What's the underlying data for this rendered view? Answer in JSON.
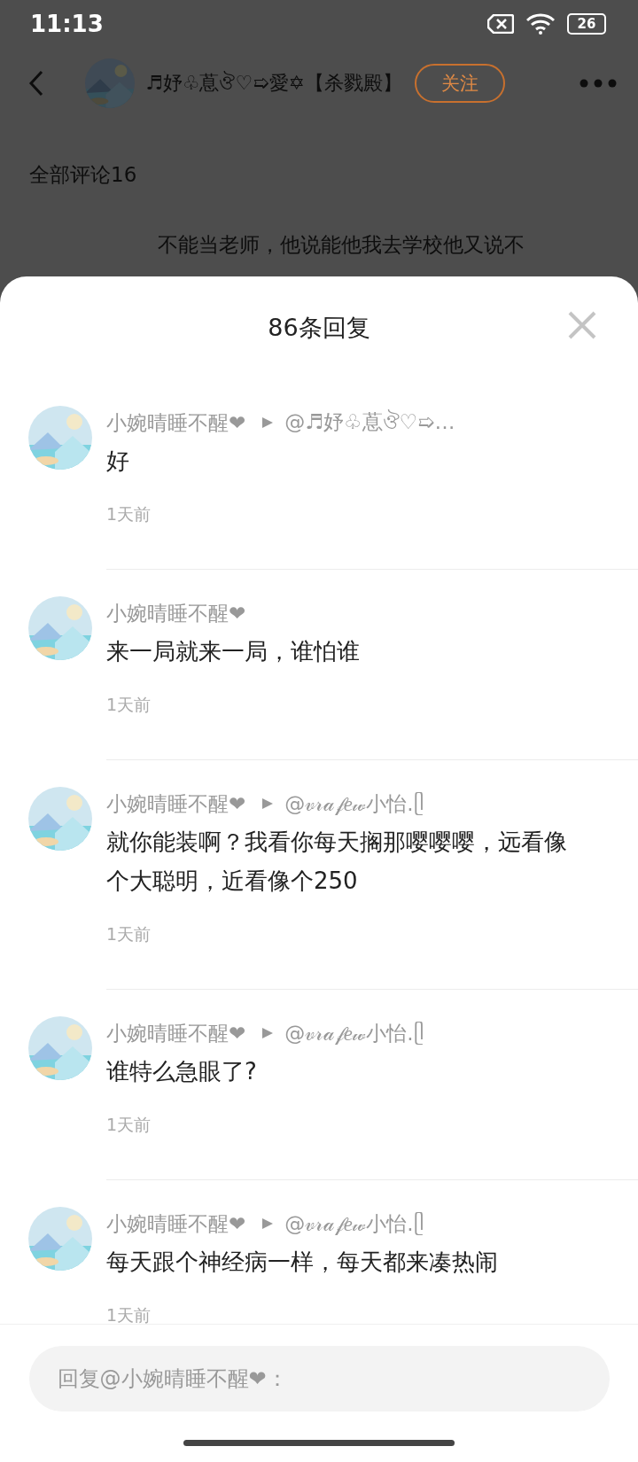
{
  "status_bar": {
    "time": "11:13",
    "battery": "26"
  },
  "header": {
    "title": "♬妤♧蒠ঔ♡➯愛✡【杀戮殿】",
    "follow_button": "关注"
  },
  "comments_heading": "全部评论16",
  "background_text": [
    "不能当老师，他说能他我去学校他又说不"
  ],
  "sheet": {
    "title": "86条回复",
    "replies": [
      {
        "author": "小婉晴睡不醒❤",
        "target": "@♬妤♧蒠ঔ♡➯…",
        "text": "好",
        "time": "1天前"
      },
      {
        "author": "小婉晴睡不醒❤",
        "text": "来一局就来一局，谁怕谁",
        "time": "1天前"
      },
      {
        "author": "小婉晴睡不醒❤",
        "target": "@𝓋𝓇𝒶𝒻𝑒𝓌小怡.ᥫ",
        "text": "就你能装啊？我看你每天搁那嘤嘤嘤，远看像个大聪明，近看像个250",
        "time": "1天前"
      },
      {
        "author": "小婉晴睡不醒❤",
        "target": "@𝓋𝓇𝒶𝒻𝑒𝓌小怡.ᥫ",
        "text": "谁特么急眼了?",
        "time": "1天前"
      },
      {
        "author": "小婉晴睡不醒❤",
        "target": "@𝓋𝓇𝒶𝒻𝑒𝓌小怡.ᥫ",
        "text": "每天跟个神经病一样，每天都来凑热闹",
        "time": "1天前"
      }
    ],
    "reply_field": {
      "placeholder": "回复@小婉晴睡不醒❤："
    }
  }
}
